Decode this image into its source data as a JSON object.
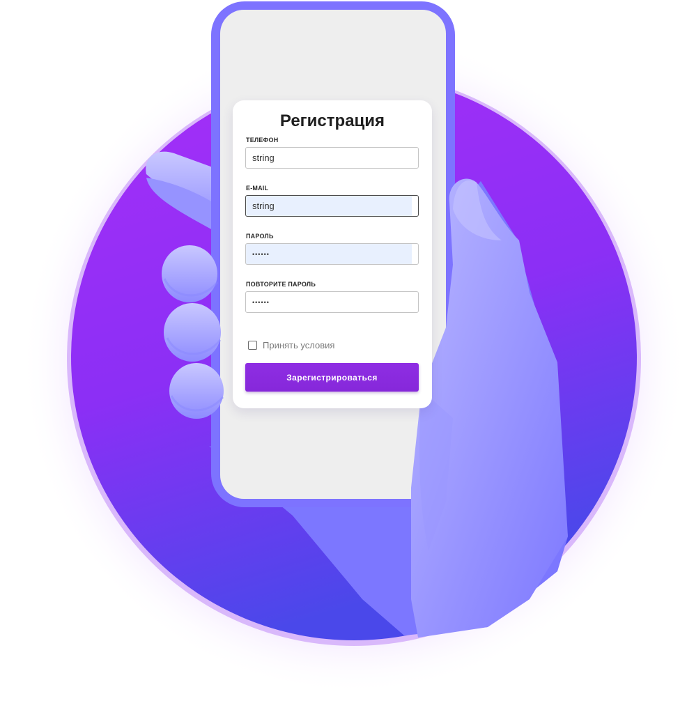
{
  "form": {
    "title": "Регистрация",
    "fields": [
      {
        "label": "ТЕЛЕФОН",
        "value": "string"
      },
      {
        "label": "E-MAIL",
        "value": "string"
      },
      {
        "label": "ПАРОЛЬ",
        "value": "••••••"
      },
      {
        "label": "ПОВТОРИТЕ ПАРОЛЬ",
        "value": "••••••"
      }
    ],
    "terms": {
      "label": "Принять условия",
      "checked": false
    },
    "submit_label": "Зарегистрироваться"
  },
  "colors": {
    "circle_top": "#a02ff6",
    "circle_bottom": "#4b47ea",
    "phone_frame": "#7b72ff",
    "screen_bg": "#eeeeee",
    "hand": "#8f8cff",
    "button": "#8a2be2"
  },
  "icons": [
    "checkbox-icon"
  ]
}
